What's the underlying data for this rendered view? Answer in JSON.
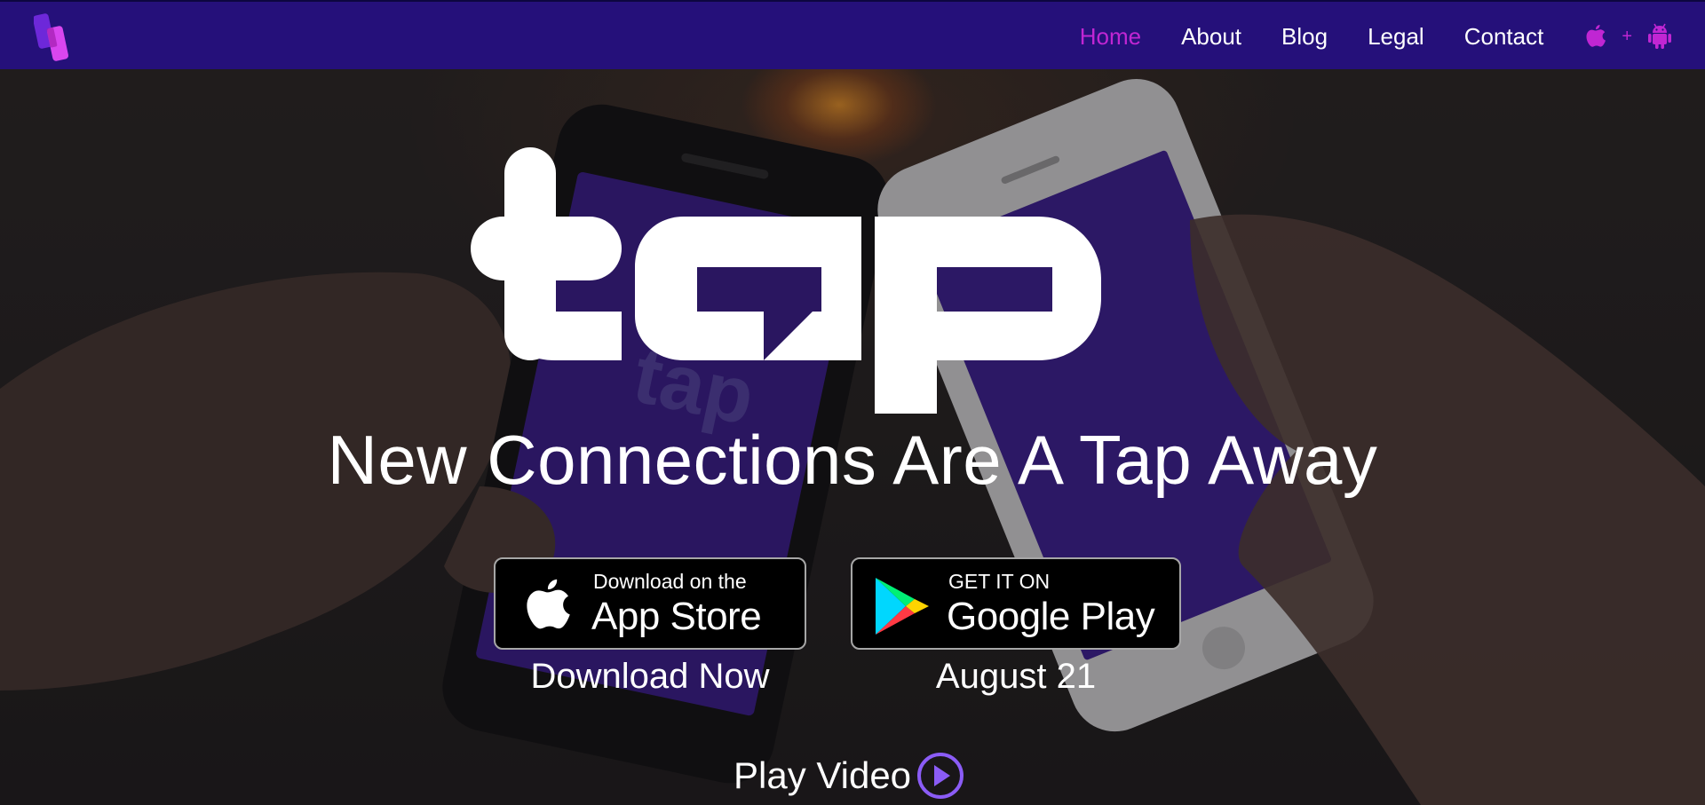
{
  "nav": {
    "links": [
      {
        "label": "Home",
        "active": true
      },
      {
        "label": "About"
      },
      {
        "label": "Blog"
      },
      {
        "label": "Legal"
      },
      {
        "label": "Contact"
      }
    ],
    "os_separator": "+",
    "os_icons": [
      "apple-icon",
      "android-icon"
    ]
  },
  "hero": {
    "wordmark": "tap",
    "tagline": "New Connections Are A Tap Away",
    "app_store": {
      "small": "Download on the",
      "big": "App Store",
      "caption": "Download Now"
    },
    "google_play": {
      "small": "GET IT ON",
      "big": "Google Play",
      "caption": "August 21"
    },
    "play_video": "Play Video"
  },
  "colors": {
    "nav_bg": "#25107a",
    "accent": "#c026d3",
    "store_button_bg": "#000000"
  }
}
